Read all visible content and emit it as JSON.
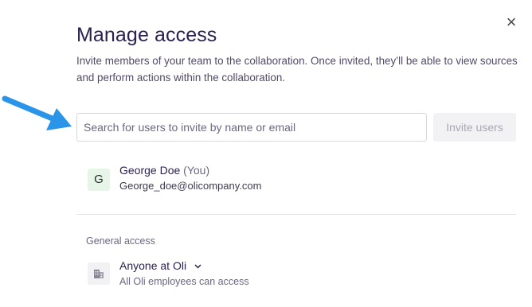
{
  "dialog": {
    "title": "Manage access",
    "description": "Invite members of your team to the collaboration. Once invited, they’ll be able to view sources and perform actions within the collaboration.",
    "close_icon": "close-icon"
  },
  "invite": {
    "placeholder": "Search for users to invite by name or email",
    "button_label": "Invite users",
    "button_enabled": false
  },
  "users": [
    {
      "initial": "G",
      "name": "George Doe",
      "tag": "(You)",
      "email": "George_doe@olicompany.com"
    }
  ],
  "general_access": {
    "label": "General access",
    "selected": "Anyone at Oli",
    "subtext": "All Oli employees can access",
    "icon": "building-icon"
  },
  "annotation": {
    "icon": "arrow-icon",
    "color": "#2a94e8"
  }
}
